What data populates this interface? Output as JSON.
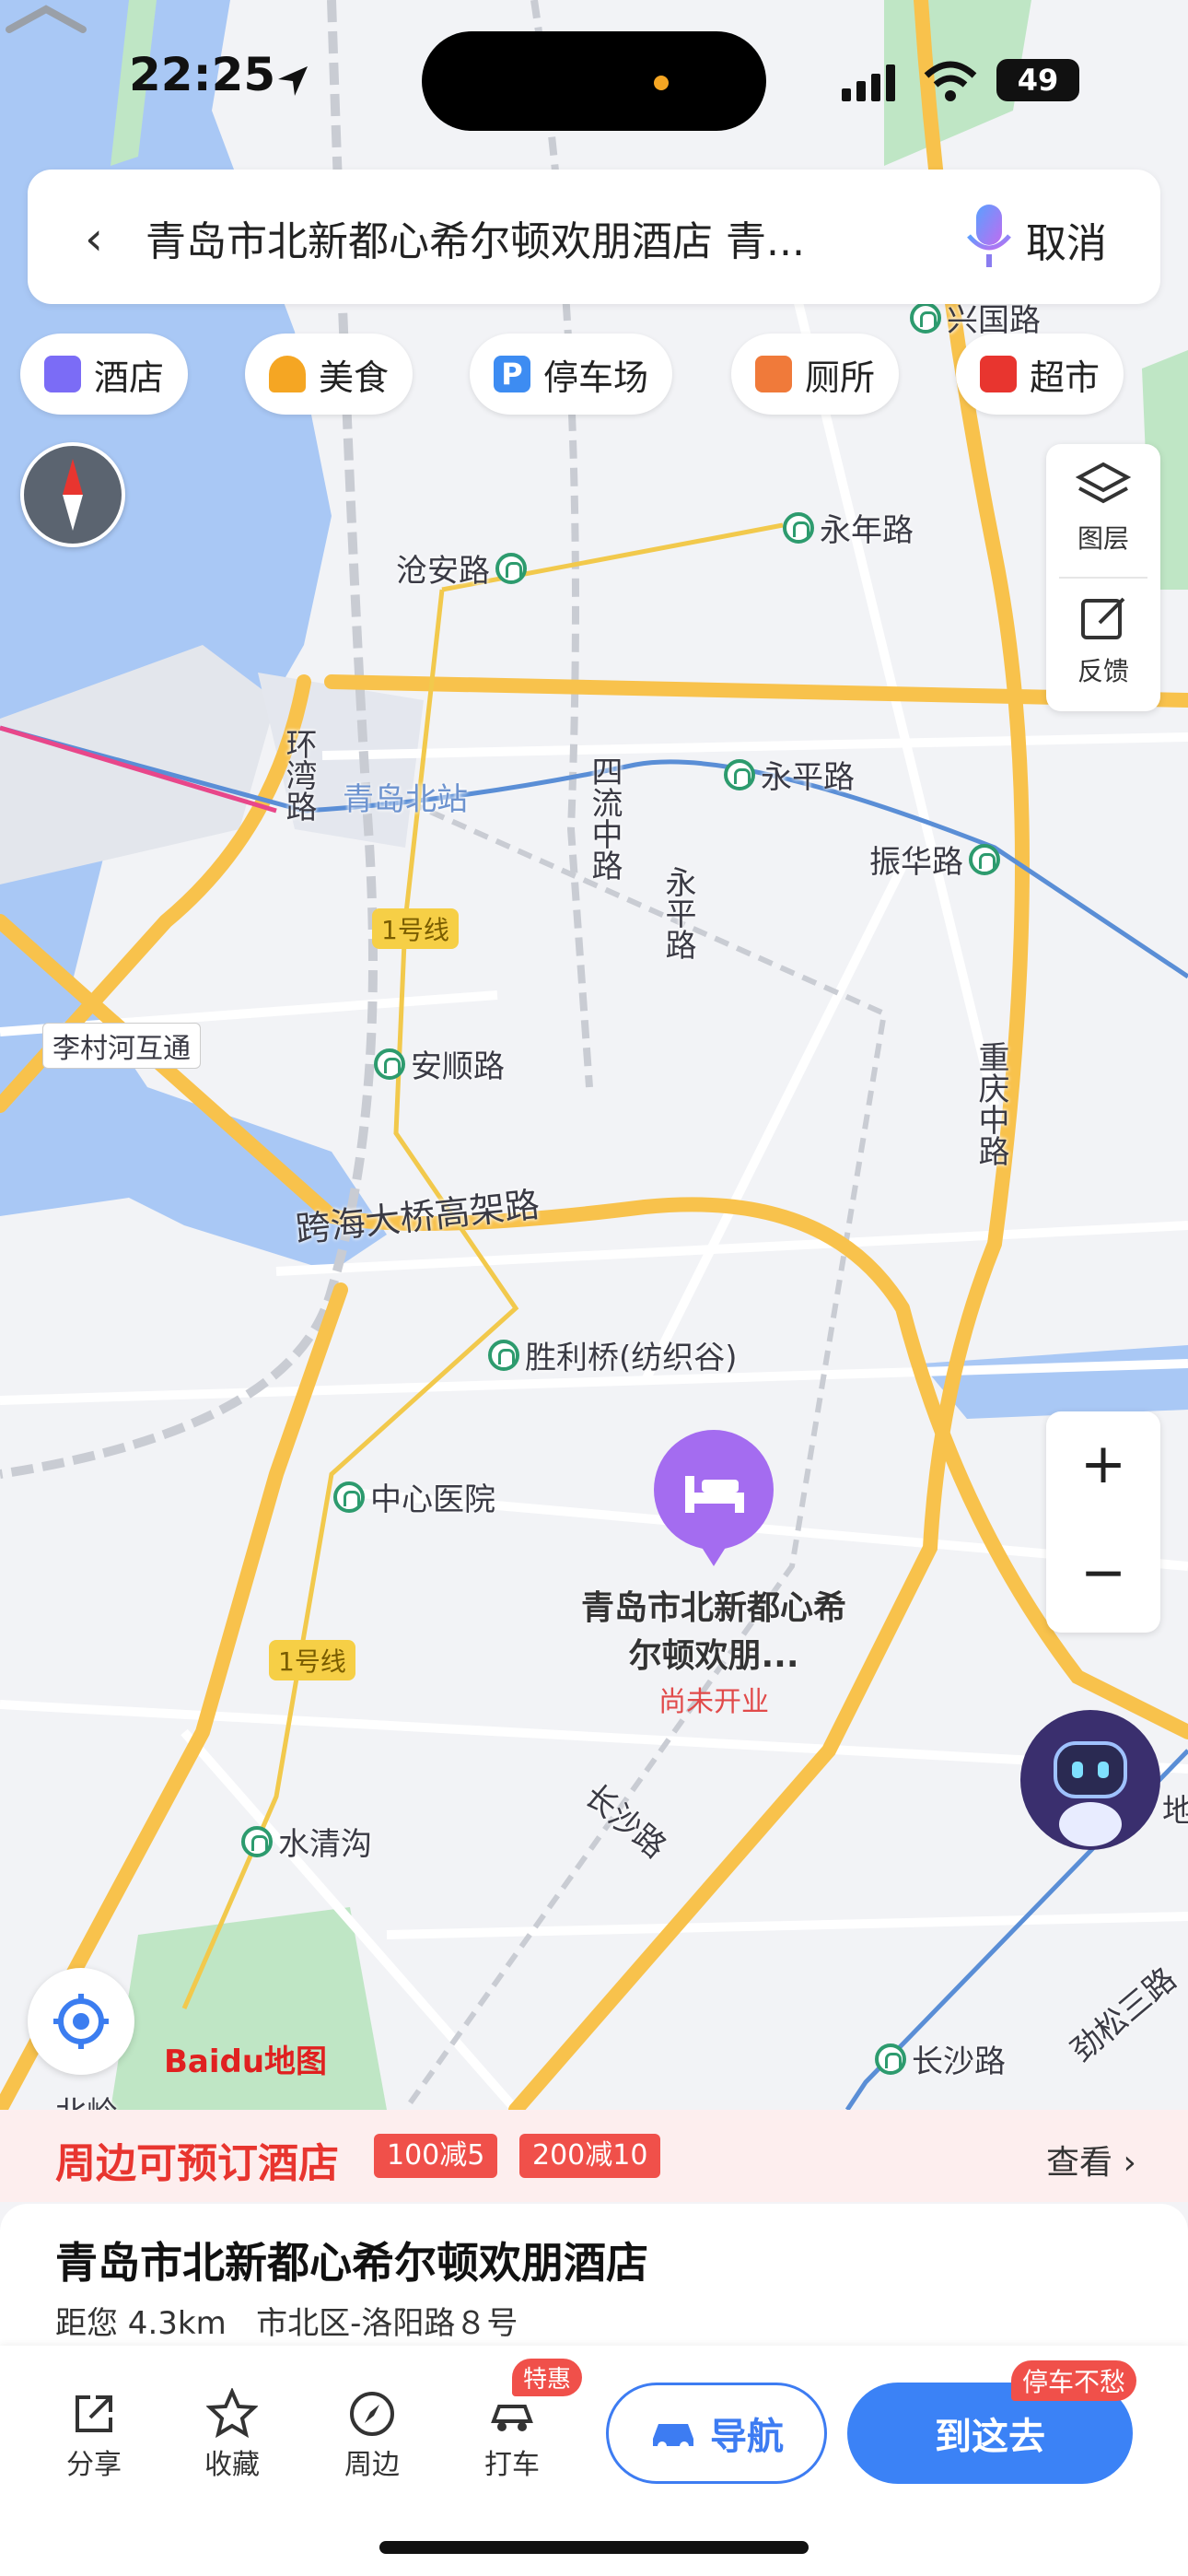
{
  "status_bar": {
    "time": "22:25",
    "battery": "49"
  },
  "search": {
    "query": "青岛市北新都心希尔顿欢朋酒店 青...",
    "cancel": "取消"
  },
  "categories": [
    {
      "label": "酒店",
      "icon": "hotel-icon",
      "color": "#7b6cf6"
    },
    {
      "label": "美食",
      "icon": "food-icon",
      "color": "#f5a623"
    },
    {
      "label": "停车场",
      "icon": "parking-icon",
      "color": "#3d8cf2"
    },
    {
      "label": "厕所",
      "icon": "toilet-icon",
      "color": "#f07a3a"
    },
    {
      "label": "超市",
      "icon": "cart-icon",
      "color": "#e8352f"
    }
  ],
  "tools": {
    "layers": "图层",
    "feedback": "反馈",
    "zoom_in": "+",
    "zoom_out": "−"
  },
  "map_labels": {
    "xingguo": "兴国路",
    "yongnian": "永年路",
    "cangan": "沧安路",
    "huanwan": "环湾路",
    "qingdaobei": "青岛北站",
    "sizhongliu": "四流中路",
    "yongping_st": "永平路",
    "yongping_rd": "永平路",
    "zhenhua": "振华路",
    "line1_a": "1号线",
    "licun": "李村河互通",
    "anshun": "安顺路",
    "chongqing": "重庆中路",
    "kuahai": "跨海大桥高架路",
    "shengli": "胜利桥(纺织谷)",
    "zhongxin": "中心医院",
    "line1_b": "1号线",
    "changsha": "长沙路",
    "shuiqing": "水清沟",
    "changsha_st": "长沙路",
    "jinsong": "劲松三路",
    "di": "地",
    "beiling": "北岭"
  },
  "poi": {
    "name": "青岛市北新都心希尔顿欢朋...",
    "status": "尚未开业"
  },
  "logo": "Baidu地图",
  "promo": {
    "title": "周边可预订酒店",
    "badges": [
      "100减5",
      "200减10"
    ],
    "more": "查看 ›"
  },
  "place": {
    "name": "青岛市北新都心希尔顿欢朋酒店",
    "distance": "距您 4.3km",
    "address": "市北区-洛阳路８号"
  },
  "actions": {
    "share": "分享",
    "favorite": "收藏",
    "nearby": "周边",
    "taxi": "打车",
    "taxi_tag": "特惠",
    "navigate": "导航",
    "go": "到这去",
    "go_tag": "停车不愁"
  }
}
